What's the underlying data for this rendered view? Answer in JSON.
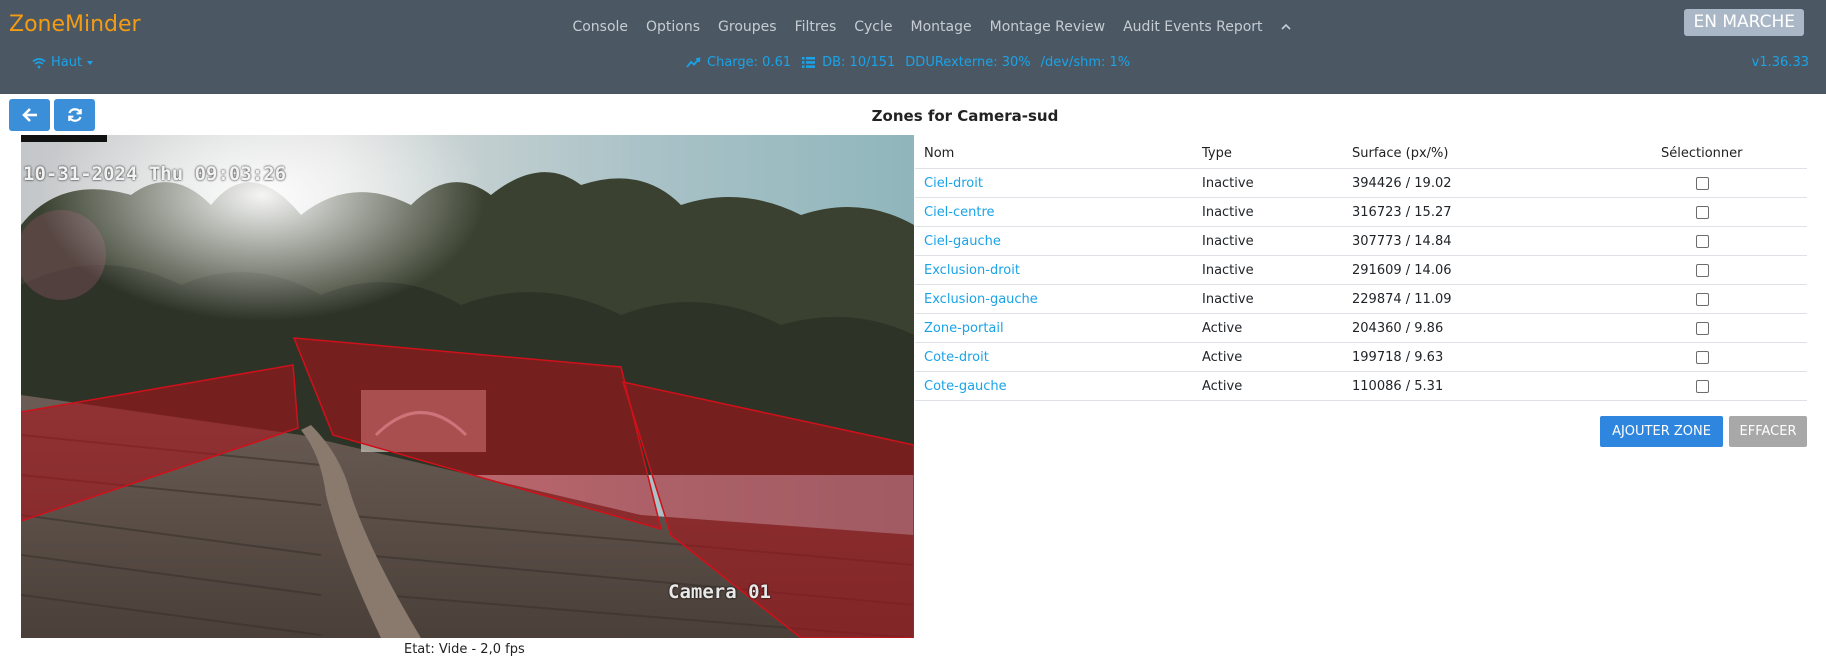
{
  "header": {
    "brand": "ZoneMinder",
    "nav": [
      "Console",
      "Options",
      "Groupes",
      "Filtres",
      "Cycle",
      "Montage",
      "Montage Review",
      "Audit Events Report"
    ],
    "status_badge": "EN MARCHE"
  },
  "subnav": {
    "bandwidth_label": "Haut",
    "load": "Charge: 0.61",
    "db": "DB: 10/151",
    "ddu": "DDURexterne: 30%",
    "shm": "/dev/shm: 1%",
    "version": "v1.36.33"
  },
  "page": {
    "title": "Zones for Camera-sud"
  },
  "camera": {
    "timestamp": "10-31-2024 Thu 09:03:26",
    "name": "Camera 01",
    "status": "Etat: Vide - 2,0 fps"
  },
  "zones_table": {
    "headers": {
      "name": "Nom",
      "type": "Type",
      "area": "Surface (px/%)",
      "select": "Sélectionner"
    },
    "rows": [
      {
        "name": "Ciel-droit",
        "type": "Inactive",
        "area": "394426 / 19.02"
      },
      {
        "name": "Ciel-centre",
        "type": "Inactive",
        "area": "316723 / 15.27"
      },
      {
        "name": "Ciel-gauche",
        "type": "Inactive",
        "area": "307773 / 14.84"
      },
      {
        "name": "Exclusion-droit",
        "type": "Inactive",
        "area": "291609 / 14.06"
      },
      {
        "name": "Exclusion-gauche",
        "type": "Inactive",
        "area": "229874 / 11.09"
      },
      {
        "name": "Zone-portail",
        "type": "Active",
        "area": "204360 / 9.86"
      },
      {
        "name": "Cote-droit",
        "type": "Active",
        "area": "199718 / 9.63"
      },
      {
        "name": "Cote-gauche",
        "type": "Active",
        "area": "110086 / 5.31"
      }
    ]
  },
  "buttons": {
    "add_zone": "AJOUTER ZONE",
    "clear": "EFFACER"
  },
  "colors": {
    "navbar": "#4b5864",
    "brand": "#f39c12",
    "link": "#1aa3e8",
    "primary_button": "#2e86de",
    "zone_fill": "#b0101a"
  },
  "icons": [
    "wifi-icon",
    "caret-down-icon",
    "chart-line-icon",
    "database-icon",
    "chevron-up-icon",
    "arrow-left-icon",
    "refresh-icon"
  ]
}
